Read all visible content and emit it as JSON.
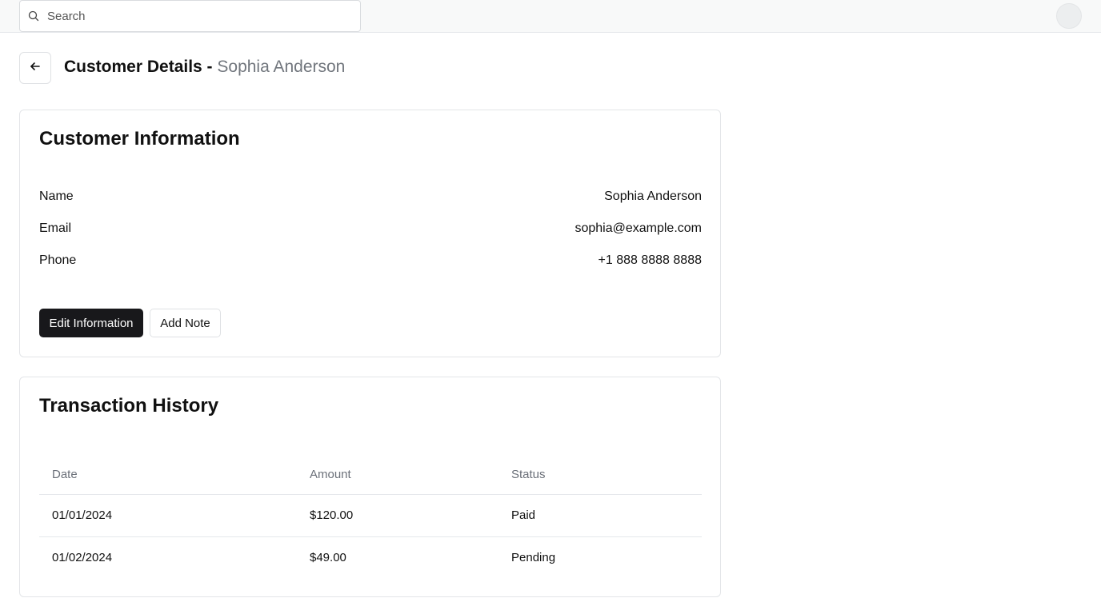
{
  "search": {
    "placeholder": "Search"
  },
  "header": {
    "title": "Customer Details - ",
    "customer_name": "Sophia Anderson"
  },
  "customer_info": {
    "heading": "Customer Information",
    "fields": [
      {
        "label": "Name",
        "value": "Sophia Anderson"
      },
      {
        "label": "Email",
        "value": "sophia@example.com"
      },
      {
        "label": "Phone",
        "value": "+1 888 8888 8888"
      }
    ],
    "edit_button": "Edit Information",
    "note_button": "Add Note"
  },
  "transactions": {
    "heading": "Transaction History",
    "columns": [
      "Date",
      "Amount",
      "Status"
    ],
    "rows": [
      {
        "date": "01/01/2024",
        "amount": "$120.00",
        "status": "Paid"
      },
      {
        "date": "01/02/2024",
        "amount": "$49.00",
        "status": "Pending"
      }
    ]
  },
  "icons": {
    "search": "search-icon",
    "back": "arrow-left-icon",
    "avatar": "avatar"
  }
}
